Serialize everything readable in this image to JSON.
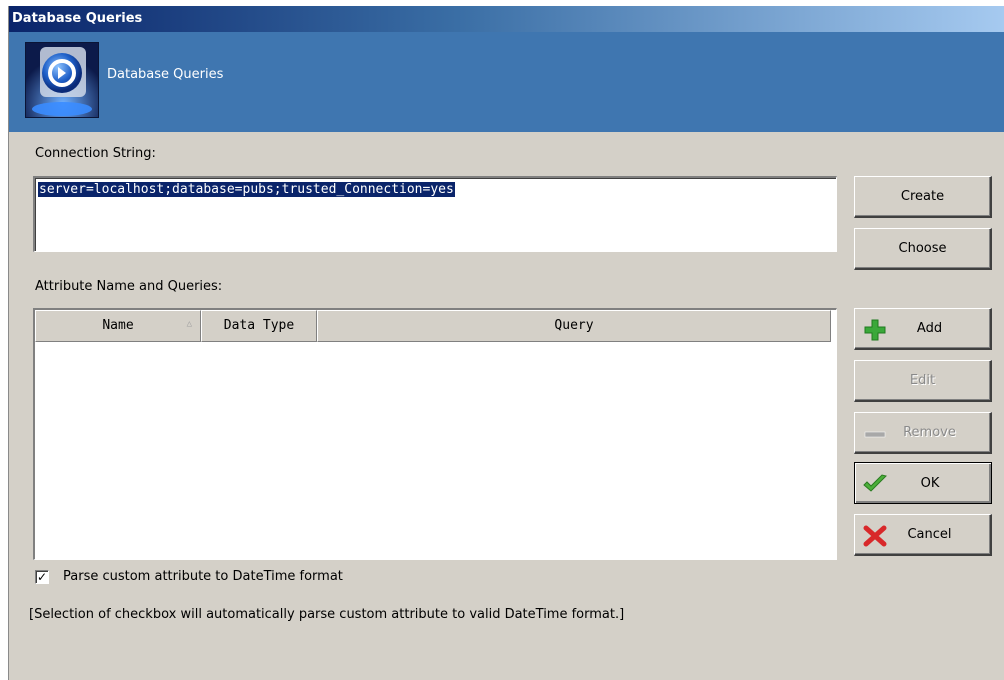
{
  "window": {
    "title": "Database Queries"
  },
  "banner": {
    "title": "Database Queries",
    "icon": "database-connection-icon"
  },
  "connection": {
    "label": "Connection String:",
    "value": "server=localhost;database=pubs;trusted_Connection=yes"
  },
  "buttons": {
    "create": "Create",
    "choose": "Choose",
    "add": "Add",
    "edit": "Edit",
    "remove": "Remove",
    "ok": "OK",
    "cancel": "Cancel"
  },
  "attributes": {
    "label": "Attribute Name and Queries:",
    "columns": [
      "Name",
      "Data Type",
      "Query"
    ],
    "rows": []
  },
  "options": {
    "parse_checkbox_label": "Parse custom attribute to DateTime format",
    "parse_checked": true,
    "note": "[Selection of checkbox will automatically parse custom attribute to valid DateTime format.]"
  },
  "colors": {
    "banner": "#3f76b0",
    "selection": "#0a246a",
    "add_icon": "#3aa83a",
    "ok_icon": "#4caf3a",
    "cancel_icon": "#d8282a"
  }
}
